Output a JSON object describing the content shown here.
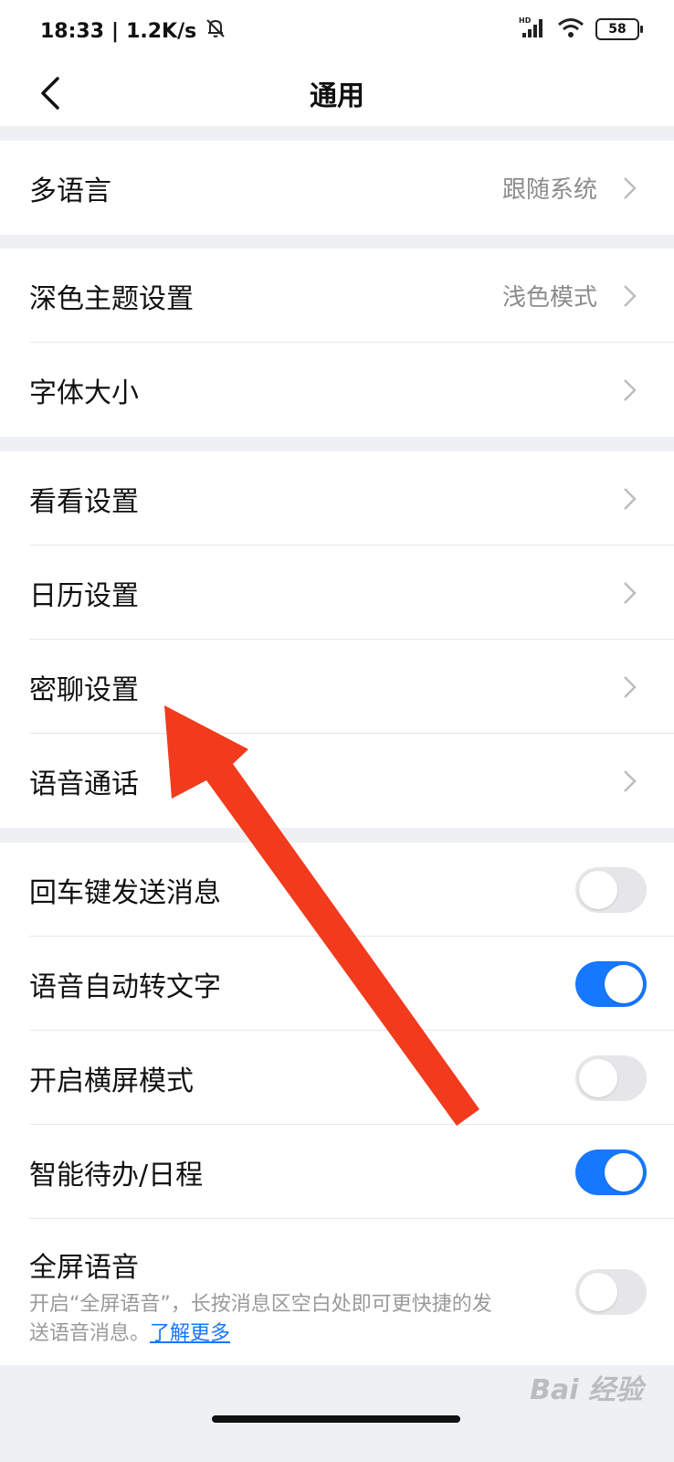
{
  "statusbar": {
    "time": "18:33",
    "network_speed": "1.2K/s",
    "battery": "58",
    "net_type": "HD"
  },
  "header": {
    "title": "通用"
  },
  "sections": [
    {
      "rows": [
        {
          "label": "多语言",
          "value": "跟随系统"
        }
      ]
    },
    {
      "rows": [
        {
          "label": "深色主题设置",
          "value": "浅色模式"
        },
        {
          "label": "字体大小",
          "value": ""
        }
      ]
    },
    {
      "rows": [
        {
          "label": "看看设置"
        },
        {
          "label": "日历设置"
        },
        {
          "label": "密聊设置"
        },
        {
          "label": "语音通话"
        }
      ]
    },
    {
      "rows": [
        {
          "label": "回车键发送消息",
          "toggle": false
        },
        {
          "label": "语音自动转文字",
          "toggle": true
        },
        {
          "label": "开启横屏模式",
          "toggle": false
        },
        {
          "label": "智能待办/日程",
          "toggle": true
        },
        {
          "label": "全屏语音",
          "toggle": false,
          "description": "开启“全屏语音”，长按消息区空白处即可更快捷的发送语音消息。",
          "link": "了解更多"
        }
      ]
    }
  ],
  "watermark": "Bai 经验",
  "colors": {
    "accent": "#1677ff",
    "toggle_off": "#e6e6e8",
    "arrow": "#f23a1c",
    "page_bg": "#eef0f4"
  }
}
